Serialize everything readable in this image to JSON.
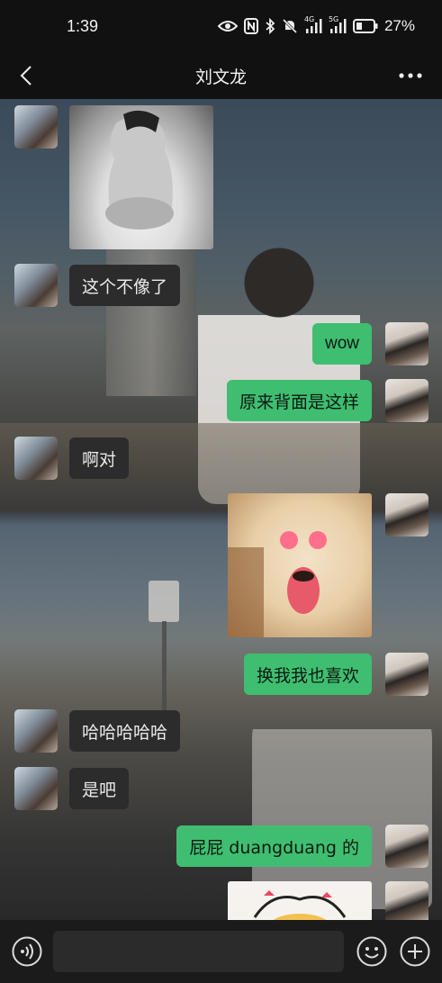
{
  "status_bar": {
    "time": "1:39",
    "signal_4g": "4G",
    "signal_5g": "5G",
    "battery": "27%"
  },
  "header": {
    "title": "刘文龙"
  },
  "messages": [
    {
      "side": "left",
      "type": "image",
      "content": "photo"
    },
    {
      "side": "left",
      "type": "text",
      "text": "这个不像了"
    },
    {
      "side": "right",
      "type": "text",
      "text": "wow"
    },
    {
      "side": "right",
      "type": "text",
      "text": "原来背面是这样"
    },
    {
      "side": "left",
      "type": "text",
      "text": "啊对"
    },
    {
      "side": "right",
      "type": "image",
      "content": "dog-sticker"
    },
    {
      "side": "right",
      "type": "text",
      "text": "换我我也喜欢"
    },
    {
      "side": "left",
      "type": "text",
      "text": "哈哈哈哈哈"
    },
    {
      "side": "left",
      "type": "text",
      "text": "是吧"
    },
    {
      "side": "right",
      "type": "text",
      "text": "屁屁 duangduang 的"
    },
    {
      "side": "right",
      "type": "image",
      "content": "cartoon-sticker"
    }
  ],
  "colors": {
    "bubble_right": "#3fbe71",
    "bubble_left": "#2c2c2c",
    "bar_bg": "#111111"
  },
  "icons": {
    "back": "chevron-left-icon",
    "more": "more-dots-icon",
    "voice": "voice-icon",
    "emoji": "emoji-icon",
    "plus": "plus-icon"
  }
}
